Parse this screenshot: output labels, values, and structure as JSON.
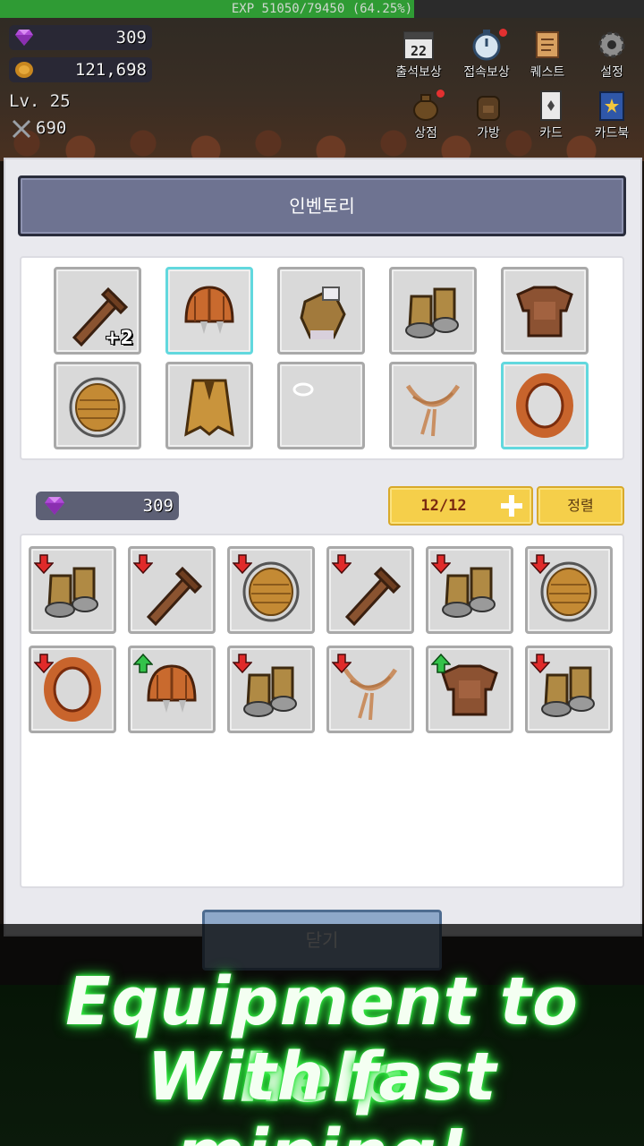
{
  "hud": {
    "exp_text": "EXP 51050/79450 (64.25%)",
    "exp_progress": 0.6425,
    "gems": "309",
    "gold": "121,698",
    "level": "Lv. 25",
    "attack": "690",
    "menu": [
      {
        "id": "attendance",
        "label": "출석보상",
        "icon": "calendar-icon",
        "badge": "22"
      },
      {
        "id": "connect",
        "label": "접속보상",
        "icon": "stopwatch-icon"
      },
      {
        "id": "quest",
        "label": "퀘스트",
        "icon": "scroll-icon"
      },
      {
        "id": "settings",
        "label": "설정",
        "icon": "gear-icon"
      },
      {
        "id": "shop",
        "label": "상점",
        "icon": "money-bag-icon"
      },
      {
        "id": "bag",
        "label": "가방",
        "icon": "backpack-icon"
      },
      {
        "id": "card",
        "label": "카드",
        "icon": "card-icon"
      },
      {
        "id": "cardbook",
        "label": "카드북",
        "icon": "book-icon"
      }
    ]
  },
  "inventory": {
    "title": "인벤토리",
    "equipped": [
      {
        "item": "sword-icon",
        "plus": "+2"
      },
      {
        "item": "helmet-icon",
        "selected": true
      },
      {
        "item": "glove-icon"
      },
      {
        "item": "boots-icon"
      },
      {
        "item": "armor-icon"
      },
      {
        "item": "shield-icon"
      },
      {
        "item": "cape-icon"
      },
      {
        "item": "empty-ring-slot-icon"
      },
      {
        "item": "necklace-icon"
      },
      {
        "item": "ring-icon",
        "selected": true
      }
    ],
    "gems": "309",
    "capacity": "12/12",
    "sort_label": "정렬",
    "bag_items": [
      {
        "item": "boots-icon",
        "trend": "down"
      },
      {
        "item": "sword-icon",
        "trend": "down"
      },
      {
        "item": "shield-icon",
        "trend": "down"
      },
      {
        "item": "sword-icon",
        "trend": "down"
      },
      {
        "item": "boots-icon",
        "trend": "down"
      },
      {
        "item": "shield-icon",
        "trend": "down"
      },
      {
        "item": "ring-icon",
        "trend": "down"
      },
      {
        "item": "helmet-icon",
        "trend": "up"
      },
      {
        "item": "boots-icon",
        "trend": "down"
      },
      {
        "item": "necklace-icon",
        "trend": "down"
      },
      {
        "item": "armor-icon",
        "trend": "up"
      },
      {
        "item": "boots-icon",
        "trend": "down"
      }
    ],
    "close_label": "닫기"
  },
  "promo": {
    "line1": "Equipment to help",
    "line2": "With fast mining!"
  },
  "colors": {
    "exp_bar": "#2f9b34",
    "selected_border": "#62d8de",
    "title_bar": "#6e7391",
    "capacity_button": "#f5cf4a",
    "promo_glow": "#3fff4e"
  }
}
